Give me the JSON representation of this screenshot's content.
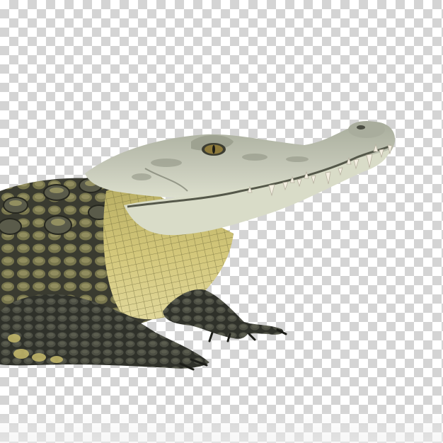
{
  "image": {
    "subject": "crocodile",
    "background": "transparent-checkerboard"
  },
  "colors": {
    "checker_light": "#ffffff",
    "checker_dark": "#d4d4d4",
    "head_top": "#b9bdae",
    "jaw_light": "#d9dcc8",
    "body_yellow": "#c9bd6a",
    "body_dark": "#2d2f28",
    "scale_dark": "#3a3c34",
    "tooth": "#f4efe2",
    "eye": "#8d7a3c"
  }
}
